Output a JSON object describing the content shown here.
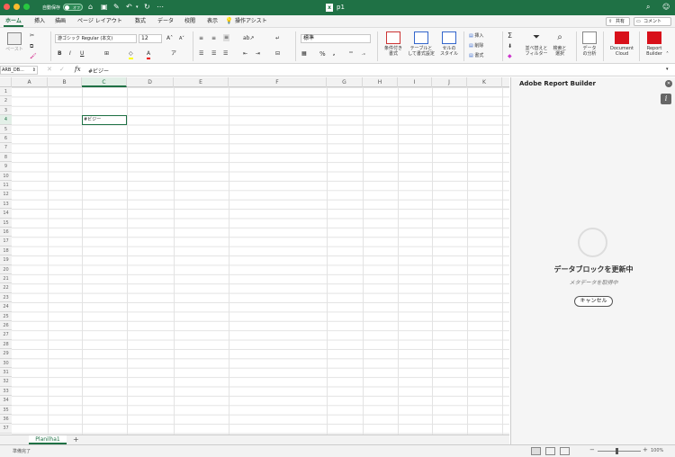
{
  "titlebar": {
    "autosave_label": "自動保存",
    "autosave_state": "オフ",
    "doc_title": "p1"
  },
  "tabs": [
    {
      "label": "ホーム"
    },
    {
      "label": "挿入"
    },
    {
      "label": "描画"
    },
    {
      "label": "ページ レイアウト"
    },
    {
      "label": "数式"
    },
    {
      "label": "データ"
    },
    {
      "label": "校閲"
    },
    {
      "label": "表示"
    }
  ],
  "tell_me": "操作アシスト",
  "share_label": "共有",
  "comment_label": "コメント",
  "ribbon": {
    "paste_label": "ペースト",
    "font_name": "游ゴシック Regular (本文)",
    "font_size": "12",
    "number_format": "標準",
    "conditional_format": [
      "条件付き",
      "書式"
    ],
    "format_as_table": [
      "テーブルと",
      "して書式設定"
    ],
    "cell_styles": [
      "セルの",
      "スタイル"
    ],
    "insert_label": "挿入",
    "delete_label": "削除",
    "format_label": "書式",
    "sort_filter": [
      "並べ替えと",
      "フィルター"
    ],
    "find_select": [
      "検索と",
      "選択"
    ],
    "analyze_data": [
      "データ",
      "の分析"
    ],
    "document_cloud": [
      "Document",
      "Cloud"
    ],
    "report_builder": [
      "Report",
      "Builder"
    ]
  },
  "formula_bar": {
    "name_box": "ARB_DB...",
    "fx_label": "fx",
    "content": "#ビジー"
  },
  "columns": [
    {
      "label": "A"
    },
    {
      "label": "B"
    },
    {
      "label": "C"
    },
    {
      "label": "D"
    },
    {
      "label": "E"
    },
    {
      "label": "F"
    },
    {
      "label": "G"
    },
    {
      "label": "H"
    },
    {
      "label": "I"
    },
    {
      "label": "J"
    },
    {
      "label": "K"
    }
  ],
  "row_count": 37,
  "selected_column": "C",
  "selected_row": 4,
  "cell_c4": "#ビジー",
  "panel": {
    "title": "Adobe Report Builder",
    "info_icon": "i",
    "status_heading": "データブロックを更新中",
    "status_sub": "メタデータを取得中",
    "cancel_label": "キャンセル"
  },
  "sheet_tab": "Planilha1",
  "status": {
    "ready": "準備完了",
    "zoom": "100%"
  },
  "colors": {
    "accent": "#1f7145"
  }
}
